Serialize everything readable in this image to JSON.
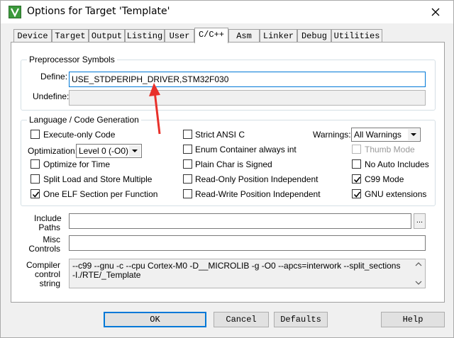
{
  "window": {
    "title": "Options for Target 'Template'"
  },
  "tabs": [
    {
      "label": "Device"
    },
    {
      "label": "Target"
    },
    {
      "label": "Output"
    },
    {
      "label": "Listing"
    },
    {
      "label": "User"
    },
    {
      "label": "C/C++"
    },
    {
      "label": "Asm"
    },
    {
      "label": "Linker"
    },
    {
      "label": "Debug"
    },
    {
      "label": "Utilities"
    }
  ],
  "preprocessor": {
    "legend": "Preprocessor Symbols",
    "define_label": "Define:",
    "define_value": "USE_STDPERIPH_DRIVER,STM32F030",
    "undefine_label": "Undefine:",
    "undefine_value": ""
  },
  "language": {
    "legend": "Language / Code Generation",
    "execute_only": "Execute-only Code",
    "optimization_label": "Optimization:",
    "optimization_value": "Level 0 (-O0)",
    "optimize_time": "Optimize for Time",
    "split_load": "Split Load and Store Multiple",
    "one_elf": "One ELF Section per Function",
    "strict_ansi": "Strict ANSI C",
    "enum_container": "Enum Container always int",
    "plain_char": "Plain Char is Signed",
    "ro_pi": "Read-Only Position Independent",
    "rw_pi": "Read-Write Position Independent",
    "warnings_label": "Warnings:",
    "warnings_value": "All Warnings",
    "thumb_mode": "Thumb Mode",
    "no_auto_includes": "No Auto Includes",
    "c99_mode": "C99 Mode",
    "gnu_ext": "GNU extensions"
  },
  "include": {
    "label_line1": "Include",
    "label_line2": "Paths",
    "value": "",
    "browse": "..."
  },
  "misc": {
    "label_line1": "Misc",
    "label_line2": "Controls",
    "value": ""
  },
  "compiler": {
    "label_line1": "Compiler",
    "label_line2": "control",
    "label_line3": "string",
    "line1": "--c99 --gnu -c --cpu Cortex-M0 -D__MICROLIB -g -O0 --apcs=interwork --split_sections",
    "line2": "-I./RTE/_Template"
  },
  "buttons": {
    "ok": "OK",
    "cancel": "Cancel",
    "defaults": "Defaults",
    "help": "Help"
  },
  "colors": {
    "annotation_arrow": "#e8302a",
    "focus_blue": "#0078d7"
  }
}
